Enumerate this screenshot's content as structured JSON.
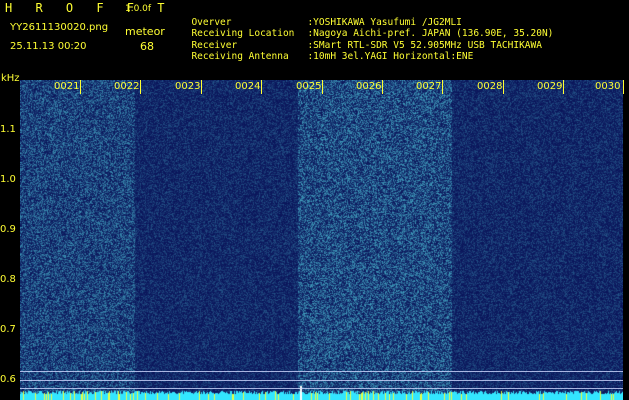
{
  "header": {
    "title": "H R O F F T",
    "version": "1.0.0f",
    "filename": "YY2611130020.png",
    "timestamp": "25.11.13 00:20",
    "meteor_label": "meteor",
    "meteor_count": "68"
  },
  "info": [
    {
      "key": "Overver",
      "value": ":YOSHIKAWA Yasufumi /JG2MLI"
    },
    {
      "key": "Receiving Location",
      "value": ":Nagoya Aichi-pref. JAPAN (136.90E, 35.20N)"
    },
    {
      "key": "Receiver",
      "value": ":SMart RTL-SDR V5 52.905MHz USB TACHIKAWA"
    },
    {
      "key": "Receiving Antenna",
      "value": ":10mH 3el.YAGI Horizontal:ENE"
    }
  ],
  "spectrogram": {
    "y_unit": "kHz",
    "y_ticks": [
      "1.1",
      "1.0",
      "0.9",
      "0.8",
      "0.7",
      "0.6"
    ],
    "time_ticks": [
      "0021",
      "0022",
      "0023",
      "0024",
      "0025",
      "0026",
      "0027",
      "0028",
      "0029",
      "0030"
    ],
    "colors": {
      "background": "#000000",
      "label": "#ffff33",
      "low": "#0a1860",
      "high": "#6fd8ff",
      "bar": "#33e6ff"
    }
  }
}
